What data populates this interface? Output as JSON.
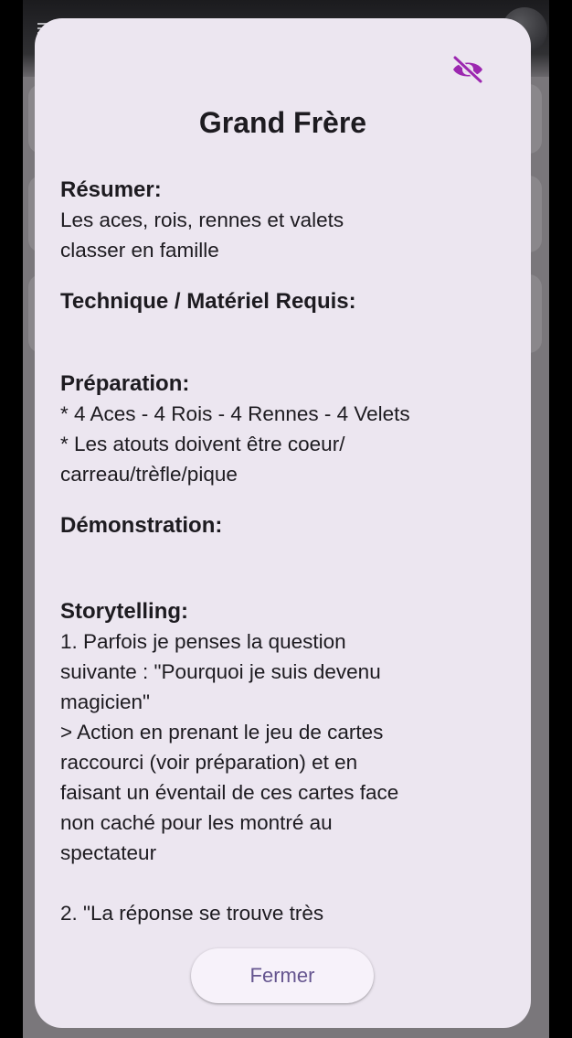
{
  "dialog": {
    "title": "Grand Frère",
    "visibility_icon": "visibility-off-icon",
    "accent_color": "#9c27b0",
    "close_label": "Fermer",
    "close_label_color": "#65558f"
  },
  "sections": {
    "resume": {
      "heading": "Résumer:",
      "text": "Les aces, rois, rennes et valets\nclasser en famille"
    },
    "technique": {
      "heading": "Technique / Matériel Requis:",
      "text": ""
    },
    "preparation": {
      "heading": "Préparation:",
      "text": "* 4 Aces - 4 Rois - 4 Rennes - 4 Velets\n* Les atouts doivent être coeur/\ncarreau/trèfle/pique"
    },
    "demonstration": {
      "heading": "Démonstration:",
      "text": ""
    },
    "storytelling": {
      "heading": "Storytelling:",
      "text": "1. Parfois je penses la question\nsuivante : \"Pourquoi je suis devenu\nmagicien\"\n> Action en prenant le jeu de cartes\nraccourci (voir préparation) et en\nfaisant un éventail de ces cartes face\nnon caché pour les montré au\nspectateur\n\n2. \"La réponse se trouve très"
    }
  }
}
